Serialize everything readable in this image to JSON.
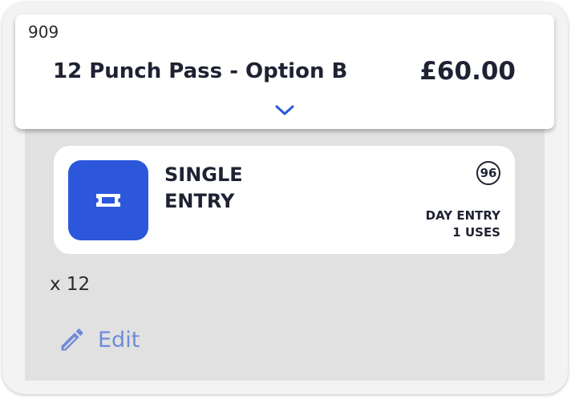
{
  "card": {
    "id": "909",
    "title": "12 Punch Pass - Option B",
    "price": "£60.00",
    "expand_icon": "chevron-down-icon"
  },
  "entry": {
    "icon": "ticket-icon",
    "name_line1": "SINGLE",
    "name_line2": "ENTRY",
    "badge": "96",
    "type": "DAY ENTRY",
    "uses": "1 USES"
  },
  "quantity": "x 12",
  "edit": {
    "label": "Edit",
    "icon": "pencil-icon"
  },
  "colors": {
    "accent": "#2c57db",
    "edit_text": "#6e8bd9",
    "panel": "#e1e1e1"
  }
}
